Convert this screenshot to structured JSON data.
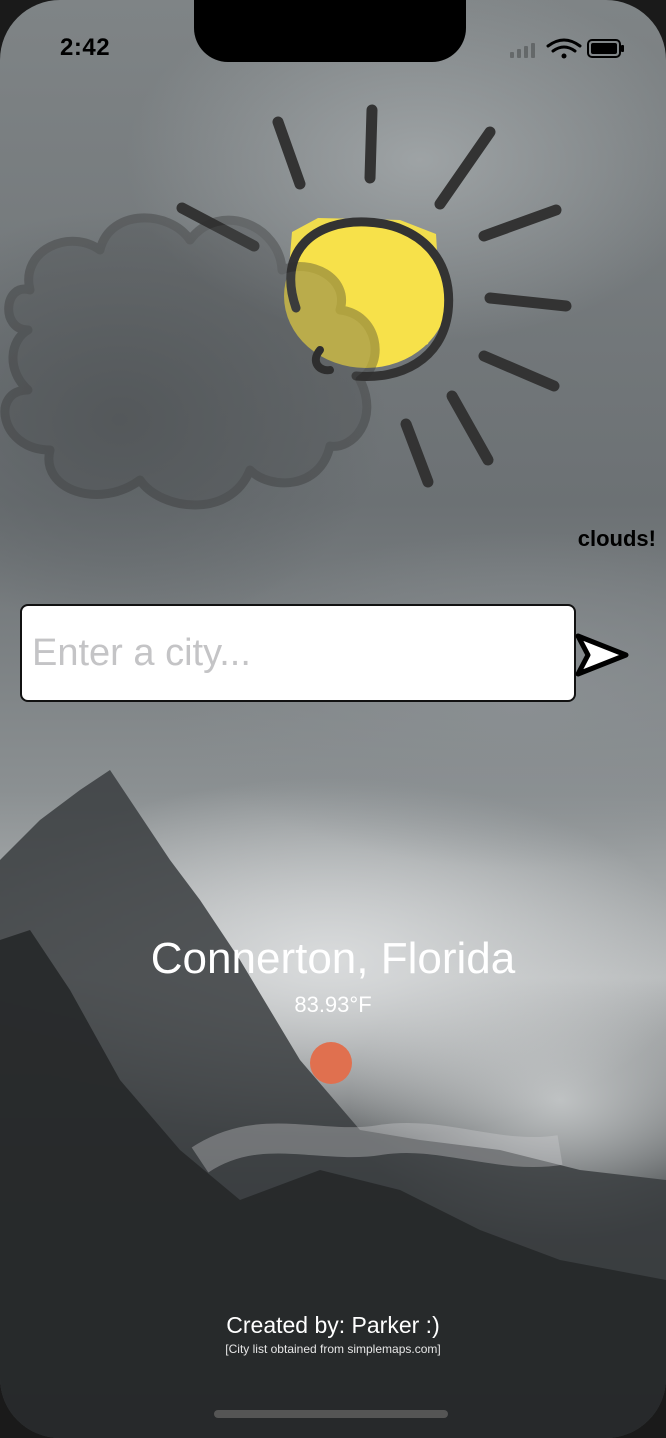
{
  "status_bar": {
    "time": "2:42"
  },
  "weather": {
    "condition": "clouds!",
    "city": "Connerton, Florida",
    "temperature": "83.93°F",
    "temperature_color": "#e0704f"
  },
  "search": {
    "placeholder": "Enter a city...",
    "value": ""
  },
  "icons": {
    "weather_art": "sun-cloud-icon",
    "send": "send-arrow-icon",
    "wifi": "wifi-icon",
    "battery": "battery-icon",
    "signal": "cellular-signal-icon"
  },
  "footer": {
    "credits": "Created by: Parker :)",
    "source_note": "[City list obtained from simplemaps.com]"
  },
  "colors": {
    "sun_fill": "#f7e14a",
    "outline": "#333333"
  }
}
